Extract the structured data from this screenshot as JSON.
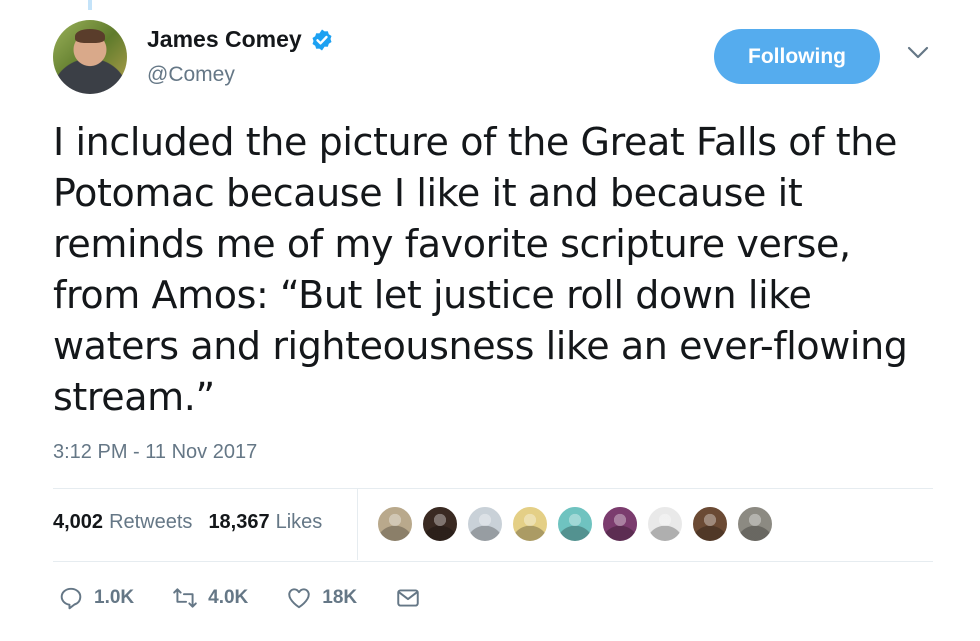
{
  "author": {
    "name": "James Comey",
    "handle": "@Comey"
  },
  "follow_button": {
    "label": "Following"
  },
  "tweet": {
    "text": "I included the picture of the Great Falls of the Potomac because I like it and because it reminds me of my favorite scripture verse, from Amos: “But let justice roll down like waters and righteousness like an ever-flowing stream.”",
    "timestamp": "3:12 PM - 11 Nov 2017"
  },
  "stats": {
    "retweets_count": "4,002",
    "retweets_label": "Retweets",
    "likes_count": "18,367",
    "likes_label": "Likes"
  },
  "liker_avatars": [
    {
      "icon": "dog-avatar-icon",
      "color": "#b9a98c"
    },
    {
      "icon": "person-avatar-icon",
      "color": "#3a2a22"
    },
    {
      "icon": "default-avatar-icon",
      "color": "#c9d1d8"
    },
    {
      "icon": "illustration-avatar-icon",
      "color": "#e4cf86"
    },
    {
      "icon": "figure-avatar-icon",
      "color": "#6fc3c0"
    },
    {
      "icon": "person-avatar-icon",
      "color": "#7b3c6e"
    },
    {
      "icon": "cartoon-avatar-icon",
      "color": "#e9e9e9"
    },
    {
      "icon": "person-avatar-icon",
      "color": "#6b4a34"
    },
    {
      "icon": "person-avatar-icon",
      "color": "#8c8a82"
    }
  ],
  "actions": {
    "reply_count": "1.0K",
    "retweet_count": "4.0K",
    "like_count": "18K"
  },
  "colors": {
    "accent": "#55acee",
    "secondary_text": "#657786",
    "primary_text": "#14171a",
    "divider": "#e6ecf0"
  }
}
